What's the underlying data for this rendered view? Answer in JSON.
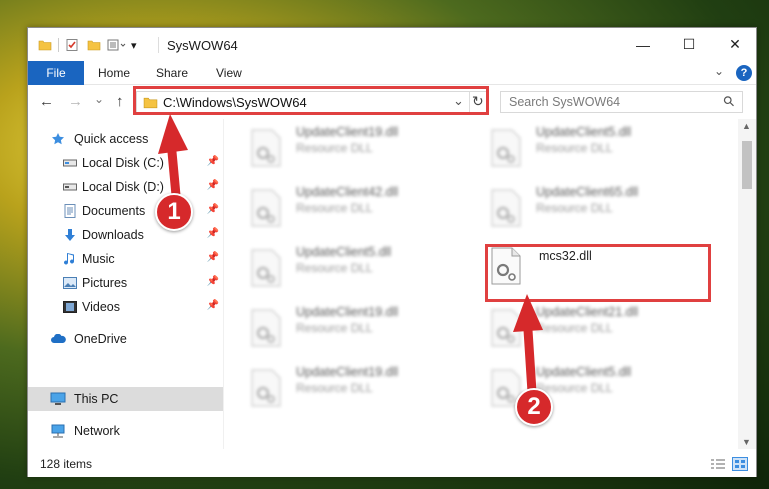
{
  "window": {
    "title": "SysWOW64",
    "minimize": "—",
    "maximize": "☐",
    "close": "✕"
  },
  "ribbon": {
    "file": "File",
    "home": "Home",
    "share": "Share",
    "view": "View",
    "collapse": "⌄",
    "help": "?"
  },
  "nav": {
    "back": "←",
    "forward": "→",
    "recent": "⌄",
    "up": "↑",
    "address": "C:\\Windows\\SysWOW64",
    "address_dropdown": "⌄",
    "refresh": "↻",
    "search_placeholder": "Search SysWOW64",
    "search_icon": "⚲"
  },
  "sidebar": {
    "quick_access": "Quick access",
    "items": [
      {
        "label": "Local Disk (C:)",
        "icon": "drive-icon",
        "pinned": true
      },
      {
        "label": "Local Disk (D:)",
        "icon": "drive-icon",
        "pinned": true
      },
      {
        "label": "Documents",
        "icon": "document-icon",
        "pinned": true
      },
      {
        "label": "Downloads",
        "icon": "download-icon",
        "pinned": true
      },
      {
        "label": "Music",
        "icon": "music-icon",
        "pinned": true
      },
      {
        "label": "Pictures",
        "icon": "picture-icon",
        "pinned": true
      },
      {
        "label": "Videos",
        "icon": "video-icon",
        "pinned": true
      }
    ],
    "onedrive": "OneDrive",
    "this_pc": "This PC",
    "network": "Network"
  },
  "files": [
    {
      "name": "UpdateClient19.dll",
      "type": "Resource DLL"
    },
    {
      "name": "UpdateClient5.dll",
      "type": "Resource DLL"
    },
    {
      "name": "UpdateClient42.dll",
      "type": "Resource DLL"
    },
    {
      "name": "UpdateClient65.dll",
      "type": "Resource DLL"
    },
    {
      "name": "UpdateClient5.dll",
      "type": "Resource DLL"
    },
    {
      "name": "mcs32.dll",
      "type": ""
    },
    {
      "name": "UpdateClient19.dll",
      "type": "Resource DLL"
    },
    {
      "name": "UpdateClient21.dll",
      "type": "Resource DLL"
    },
    {
      "name": "UpdateClient19.dll",
      "type": "Resource DLL"
    },
    {
      "name": "UpdateClient5.dll",
      "type": "Resource DLL"
    }
  ],
  "status": {
    "count": "128 items"
  },
  "annotations": {
    "step1": "1",
    "step2": "2"
  },
  "colors": {
    "accent": "#1a65c0",
    "annotation": "#d6292b",
    "folder": "#f5c342"
  }
}
